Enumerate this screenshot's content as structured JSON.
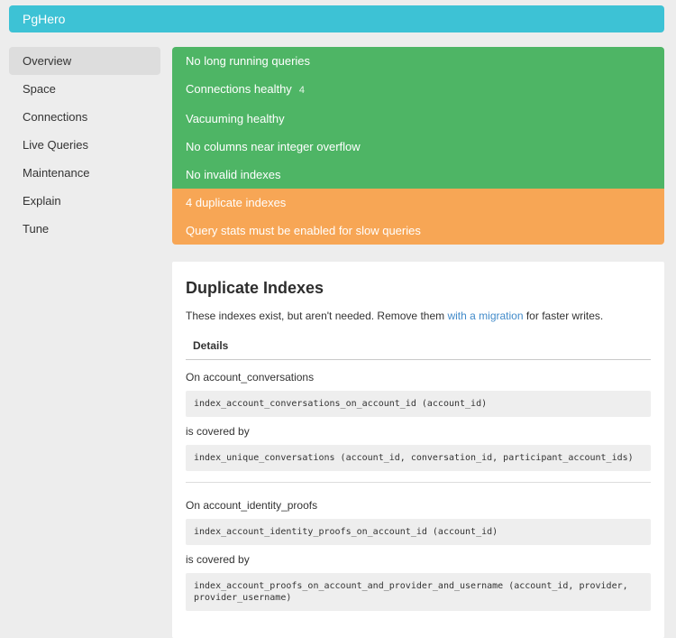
{
  "colors": {
    "navbar": "#3dc2d5",
    "success": "#4eb565",
    "warning": "#f7a655",
    "link": "#428bca",
    "page-bg": "#ededed",
    "card-bg": "#ffffff",
    "code-bg": "#eeeeee",
    "sidebar-active-bg": "#dddddd",
    "text": "#333333"
  },
  "header": {
    "brand": "PgHero"
  },
  "sidebar": {
    "items": [
      {
        "label": "Overview",
        "active": true
      },
      {
        "label": "Space"
      },
      {
        "label": "Connections"
      },
      {
        "label": "Live Queries"
      },
      {
        "label": "Maintenance"
      },
      {
        "label": "Explain"
      },
      {
        "label": "Tune"
      }
    ]
  },
  "status": {
    "success": [
      {
        "label": "No long running queries"
      },
      {
        "label": "Connections healthy",
        "count": "4"
      },
      {
        "label": "Vacuuming healthy"
      },
      {
        "label": "No columns near integer overflow"
      },
      {
        "label": "No invalid indexes"
      }
    ],
    "warning": [
      {
        "label": "4 duplicate indexes"
      },
      {
        "label": "Query stats must be enabled for slow queries"
      }
    ]
  },
  "card": {
    "title": "Duplicate Indexes",
    "desc_before": "These indexes exist, but aren't needed. Remove them ",
    "link_text": "with a migration",
    "desc_after": " for faster writes.",
    "details_header": "Details",
    "sections": [
      {
        "on_label": "On account_conversations",
        "duplicate_index": "index_account_conversations_on_account_id (account_id)",
        "covered_label": "is covered by",
        "covering_index": "index_unique_conversations (account_id, conversation_id, participant_account_ids)"
      },
      {
        "on_label": "On account_identity_proofs",
        "duplicate_index": "index_account_identity_proofs_on_account_id (account_id)",
        "covered_label": "is covered by",
        "covering_index": "index_account_proofs_on_account_and_provider_and_username (account_id, provider, provider_username)"
      }
    ]
  }
}
